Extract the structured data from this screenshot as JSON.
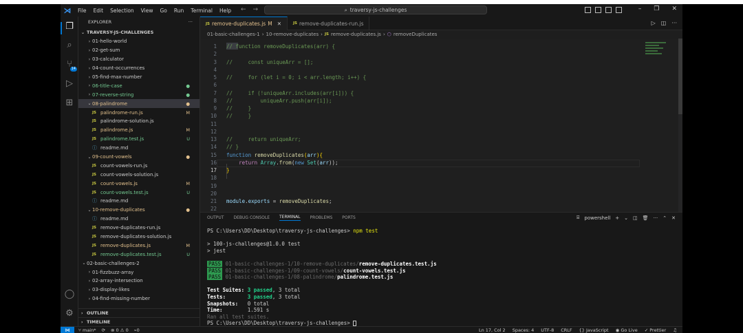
{
  "titlebar": {
    "menu": [
      "File",
      "Edit",
      "Selection",
      "View",
      "Go",
      "Run",
      "Terminal",
      "Help"
    ],
    "search": "traversy-js-challenges"
  },
  "activitybar": {
    "source_control_badge": "14"
  },
  "sidebar": {
    "header": "EXPLORER",
    "project": "TRAVERSY-JS-CHALLENGES",
    "items": [
      {
        "label": "01-hello-world",
        "kind": "folder-collapsed",
        "indent": 1
      },
      {
        "label": "02-get-sum",
        "kind": "folder-collapsed",
        "indent": 1
      },
      {
        "label": "03-calculator",
        "kind": "folder-collapsed",
        "indent": 1
      },
      {
        "label": "04-count-occurrences",
        "kind": "folder-collapsed",
        "indent": 1
      },
      {
        "label": "05-find-max-number",
        "kind": "folder-collapsed",
        "indent": 1
      },
      {
        "label": "06-title-case",
        "kind": "folder-collapsed",
        "indent": 1,
        "color": "new",
        "status": "●"
      },
      {
        "label": "07-reverse-string",
        "kind": "folder-collapsed",
        "indent": 1,
        "color": "new",
        "status": "●"
      },
      {
        "label": "08-palindrome",
        "kind": "folder-open",
        "indent": 1,
        "color": "mod",
        "status": "●",
        "selected": true
      },
      {
        "label": "palindrome-run.js",
        "kind": "js",
        "indent": 2,
        "color": "mod",
        "status": "M"
      },
      {
        "label": "palindrome-solution.js",
        "kind": "js",
        "indent": 2
      },
      {
        "label": "palindrome.js",
        "kind": "js",
        "indent": 2,
        "color": "mod",
        "status": "M"
      },
      {
        "label": "palindrome.test.js",
        "kind": "js",
        "indent": 2,
        "color": "new",
        "status": "U"
      },
      {
        "label": "readme.md",
        "kind": "info",
        "indent": 2
      },
      {
        "label": "09-count-vowels",
        "kind": "folder-open",
        "indent": 1,
        "color": "mod",
        "status": "●"
      },
      {
        "label": "count-vowels-run.js",
        "kind": "js",
        "indent": 2
      },
      {
        "label": "count-vowels-solution.js",
        "kind": "js",
        "indent": 2
      },
      {
        "label": "count-vowels.js",
        "kind": "js",
        "indent": 2,
        "color": "mod",
        "status": "M"
      },
      {
        "label": "count-vowels.test.js",
        "kind": "js",
        "indent": 2,
        "color": "new",
        "status": "U"
      },
      {
        "label": "readme.md",
        "kind": "info",
        "indent": 2
      },
      {
        "label": "10-remove-duplicates",
        "kind": "folder-open",
        "indent": 1,
        "color": "mod",
        "status": "●"
      },
      {
        "label": "readme.md",
        "kind": "info",
        "indent": 2
      },
      {
        "label": "remove-duplicates-run.js",
        "kind": "js",
        "indent": 2
      },
      {
        "label": "remove-duplicates-solution.js",
        "kind": "js",
        "indent": 2
      },
      {
        "label": "remove-duplicates.js",
        "kind": "js",
        "indent": 2,
        "color": "mod",
        "status": "M"
      },
      {
        "label": "remove-duplicates.test.js",
        "kind": "js",
        "indent": 2,
        "color": "new",
        "status": "U"
      },
      {
        "label": "02-basic-challenges-2",
        "kind": "folder-open",
        "indent": 0
      },
      {
        "label": "01-fizzbuzz-array",
        "kind": "folder-collapsed",
        "indent": 1
      },
      {
        "label": "02-array-intersection",
        "kind": "folder-collapsed",
        "indent": 1
      },
      {
        "label": "03-display-likes",
        "kind": "folder-collapsed",
        "indent": 1
      },
      {
        "label": "04-find-missing-number",
        "kind": "folder-collapsed",
        "indent": 1
      }
    ],
    "outline": "OUTLINE",
    "timeline": "TIMELINE"
  },
  "tabs": [
    {
      "label": "remove-duplicates.js",
      "suffix": "M",
      "active": true
    },
    {
      "label": "remove-duplicates-run.js",
      "suffix": "",
      "active": false
    }
  ],
  "breadcrumbs": [
    "01-basic-challenges-1",
    "10-remove-duplicates",
    "remove-duplicates.js",
    "removeDuplicates"
  ],
  "editor": {
    "current_line": 17,
    "lines": [
      {
        "n": "1",
        "html": "<span class='c-com'>// function removeDuplicates(arr) {</span>"
      },
      {
        "n": "2",
        "html": ""
      },
      {
        "n": "3",
        "html": "<span class='c-com'>//     const uniqueArr = [];</span>"
      },
      {
        "n": "4",
        "html": ""
      },
      {
        "n": "5",
        "html": "<span class='c-com'>//     for (let i = 0; i &lt; arr.length; i++) {</span>"
      },
      {
        "n": "6",
        "html": ""
      },
      {
        "n": "7",
        "html": "<span class='c-com'>//     if (!uniqueArr.includes(arr[i])) {</span>"
      },
      {
        "n": "8",
        "html": "<span class='c-com'>//         uniqueArr.push(arr[i]);</span>"
      },
      {
        "n": "9",
        "html": "<span class='c-com'>//     }</span>"
      },
      {
        "n": "10",
        "html": "<span class='c-com'>//     }</span>"
      },
      {
        "n": "11",
        "html": ""
      },
      {
        "n": "12",
        "html": ""
      },
      {
        "n": "13",
        "html": "<span class='c-com'>//     return uniqueArr;</span>"
      },
      {
        "n": "14",
        "html": "<span class='c-com'>// }</span>"
      },
      {
        "n": "15",
        "html": "<span class='c-key'>function</span> <span class='c-fn'>removeDuplicates</span><span class='c-br'>(</span><span class='c-var'>arr</span><span class='c-br'>)</span><span class='c-br'>{</span>"
      },
      {
        "n": "16",
        "html": "    <span class='c-kw'>return</span> <span class='c-cls'>Array</span><span class='c-def'>.</span><span class='c-fn'>from</span><span class='c-def'>(</span><span class='c-key'>new</span> <span class='c-cls'>Set</span><span class='c-def'>(</span><span class='c-var'>arr</span><span class='c-def'>));</span>"
      },
      {
        "n": "17",
        "html": "<span class='c-br'>}</span>"
      },
      {
        "n": "18",
        "html": ""
      },
      {
        "n": "19",
        "html": ""
      },
      {
        "n": "20",
        "html": ""
      },
      {
        "n": "21",
        "html": "<span class='c-var'>module</span><span class='c-def'>.</span><span class='c-var'>exports</span> <span class='c-def'>=</span> <span class='c-fn'>removeDuplicates</span><span class='c-def'>;</span>"
      },
      {
        "n": "22",
        "html": ""
      }
    ]
  },
  "panel": {
    "tabs": [
      "OUTPUT",
      "DEBUG CONSOLE",
      "TERMINAL",
      "PROBLEMS",
      "PORTS"
    ],
    "active_tab": "TERMINAL",
    "shell": "powershell",
    "terminal": {
      "prompt1": "PS C:\\Users\\DD\\Desktop\\traversy-js-challenges>",
      "cmd": "npm test",
      "script1": "> 100-js-challenges@1.0.0 test",
      "script2": "> jest",
      "passes": [
        {
          "dir": "01-basic-challenges-1/10-remove-duplicates/",
          "file": "remove-duplicates.test.js"
        },
        {
          "dir": "01-basic-challenges-1/09-count-vowels/",
          "file": "count-vowels.test.js"
        },
        {
          "dir": "01-basic-challenges-1/08-palindrome/",
          "file": "palindrome.test.js"
        }
      ],
      "pass_label": "PASS",
      "suites_label": "Test Suites:",
      "suites_passed": "3 passed",
      "suites_total": ", 3 total",
      "tests_label": "Tests:",
      "tests_passed": "3 passed",
      "tests_total": ", 3 total",
      "snap_label": "Snapshots:",
      "snap_value": "0 total",
      "time_label": "Time:",
      "time_value": "1.591 s",
      "ran": "Ran all test suites.",
      "prompt2": "PS C:\\Users\\DD\\Desktop\\traversy-js-challenges>"
    }
  },
  "statusbar": {
    "branch": "main*",
    "errors": "0",
    "warnings": "0",
    "ports": "0",
    "position": "Ln 17, Col 2",
    "spaces": "Spaces: 4",
    "encoding": "UTF-8",
    "eol": "CRLF",
    "language": "JavaScript",
    "golive": "Go Live",
    "prettier": "Prettier"
  }
}
